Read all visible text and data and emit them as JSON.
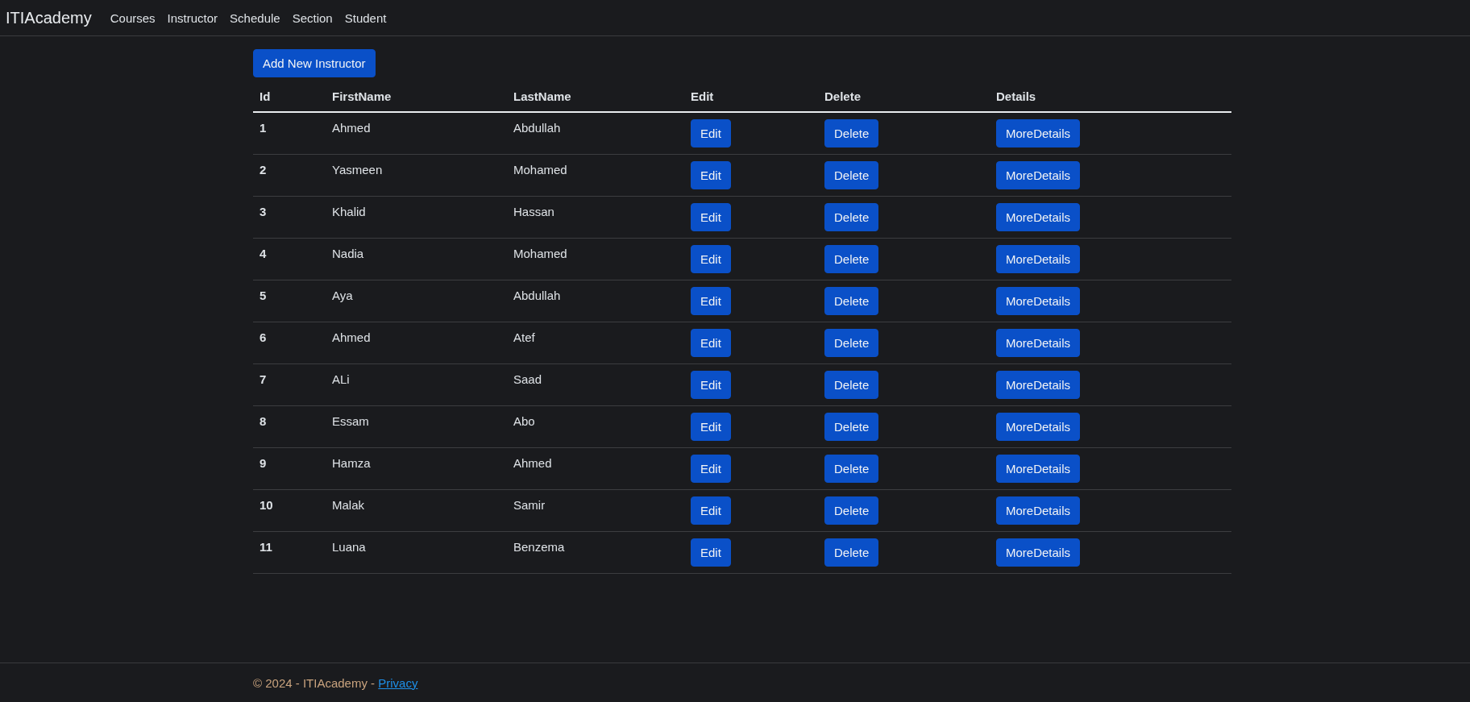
{
  "navbar": {
    "brand": "ITIAcademy",
    "links": [
      "Courses",
      "Instructor",
      "Schedule",
      "Section",
      "Student"
    ]
  },
  "add_button": "Add New Instructor",
  "table": {
    "columns": [
      "Id",
      "FirstName",
      "LastName",
      "Edit",
      "Delete",
      "Details"
    ],
    "rows": [
      {
        "id": "1",
        "first_name": "Ahmed",
        "last_name": "Abdullah",
        "edit": "Edit",
        "delete": "Delete",
        "details": "MoreDetails"
      },
      {
        "id": "2",
        "first_name": "Yasmeen",
        "last_name": "Mohamed",
        "edit": "Edit",
        "delete": "Delete",
        "details": "MoreDetails"
      },
      {
        "id": "3",
        "first_name": "Khalid",
        "last_name": "Hassan",
        "edit": "Edit",
        "delete": "Delete",
        "details": "MoreDetails"
      },
      {
        "id": "4",
        "first_name": "Nadia",
        "last_name": "Mohamed",
        "edit": "Edit",
        "delete": "Delete",
        "details": "MoreDetails"
      },
      {
        "id": "5",
        "first_name": "Aya",
        "last_name": "Abdullah",
        "edit": "Edit",
        "delete": "Delete",
        "details": "MoreDetails"
      },
      {
        "id": "6",
        "first_name": "Ahmed",
        "last_name": "Atef",
        "edit": "Edit",
        "delete": "Delete",
        "details": "MoreDetails"
      },
      {
        "id": "7",
        "first_name": "ALi",
        "last_name": "Saad",
        "edit": "Edit",
        "delete": "Delete",
        "details": "MoreDetails"
      },
      {
        "id": "8",
        "first_name": "Essam",
        "last_name": "Abo",
        "edit": "Edit",
        "delete": "Delete",
        "details": "MoreDetails"
      },
      {
        "id": "9",
        "first_name": "Hamza",
        "last_name": "Ahmed",
        "edit": "Edit",
        "delete": "Delete",
        "details": "MoreDetails"
      },
      {
        "id": "10",
        "first_name": "Malak",
        "last_name": "Samir",
        "edit": "Edit",
        "delete": "Delete",
        "details": "MoreDetails"
      },
      {
        "id": "11",
        "first_name": "Luana",
        "last_name": "Benzema",
        "edit": "Edit",
        "delete": "Delete",
        "details": "MoreDetails"
      }
    ]
  },
  "footer": {
    "text": "© 2024 - ITIAcademy - ",
    "link": "Privacy"
  }
}
